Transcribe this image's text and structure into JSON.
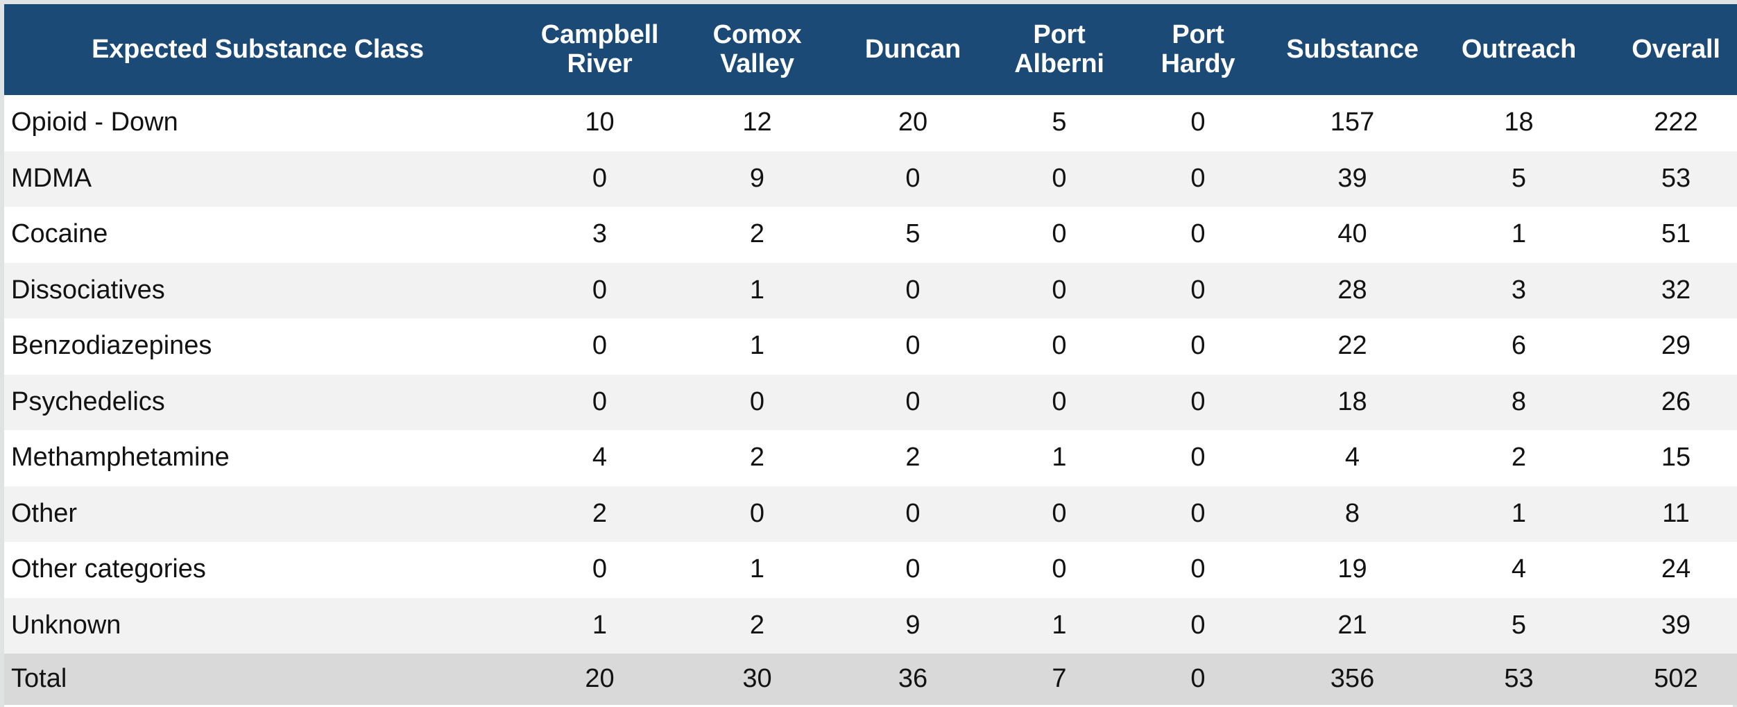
{
  "table": {
    "columns": [
      {
        "key": "class",
        "label": "Expected Substance Class",
        "align": "left"
      },
      {
        "key": "campbell_river",
        "label": "Campbell\nRiver",
        "align": "center"
      },
      {
        "key": "comox_valley",
        "label": "Comox\nValley",
        "align": "center"
      },
      {
        "key": "duncan",
        "label": "Duncan",
        "align": "center"
      },
      {
        "key": "port_alberni",
        "label": "Port\nAlberni",
        "align": "center"
      },
      {
        "key": "port_hardy",
        "label": "Port\nHardy",
        "align": "center"
      },
      {
        "key": "substance",
        "label": "Substance",
        "align": "center"
      },
      {
        "key": "outreach",
        "label": "Outreach",
        "align": "center"
      },
      {
        "key": "overall",
        "label": "Overall",
        "align": "center"
      }
    ],
    "rows": [
      {
        "class": "Opioid - Down",
        "campbell_river": "10",
        "comox_valley": "12",
        "duncan": "20",
        "port_alberni": "5",
        "port_hardy": "0",
        "substance": "157",
        "outreach": "18",
        "overall": "222"
      },
      {
        "class": "MDMA",
        "campbell_river": "0",
        "comox_valley": "9",
        "duncan": "0",
        "port_alberni": "0",
        "port_hardy": "0",
        "substance": "39",
        "outreach": "5",
        "overall": "53"
      },
      {
        "class": "Cocaine",
        "campbell_river": "3",
        "comox_valley": "2",
        "duncan": "5",
        "port_alberni": "0",
        "port_hardy": "0",
        "substance": "40",
        "outreach": "1",
        "overall": "51"
      },
      {
        "class": "Dissociatives",
        "campbell_river": "0",
        "comox_valley": "1",
        "duncan": "0",
        "port_alberni": "0",
        "port_hardy": "0",
        "substance": "28",
        "outreach": "3",
        "overall": "32"
      },
      {
        "class": "Benzodiazepines",
        "campbell_river": "0",
        "comox_valley": "1",
        "duncan": "0",
        "port_alberni": "0",
        "port_hardy": "0",
        "substance": "22",
        "outreach": "6",
        "overall": "29"
      },
      {
        "class": "Psychedelics",
        "campbell_river": "0",
        "comox_valley": "0",
        "duncan": "0",
        "port_alberni": "0",
        "port_hardy": "0",
        "substance": "18",
        "outreach": "8",
        "overall": "26"
      },
      {
        "class": "Methamphetamine",
        "campbell_river": "4",
        "comox_valley": "2",
        "duncan": "2",
        "port_alberni": "1",
        "port_hardy": "0",
        "substance": "4",
        "outreach": "2",
        "overall": "15"
      },
      {
        "class": "Other",
        "campbell_river": "2",
        "comox_valley": "0",
        "duncan": "0",
        "port_alberni": "0",
        "port_hardy": "0",
        "substance": "8",
        "outreach": "1",
        "overall": "11"
      },
      {
        "class": "Other categories",
        "campbell_river": "0",
        "comox_valley": "1",
        "duncan": "0",
        "port_alberni": "0",
        "port_hardy": "0",
        "substance": "19",
        "outreach": "4",
        "overall": "24"
      },
      {
        "class": "Unknown",
        "campbell_river": "1",
        "comox_valley": "2",
        "duncan": "9",
        "port_alberni": "1",
        "port_hardy": "0",
        "substance": "21",
        "outreach": "5",
        "overall": "39"
      }
    ],
    "total_row": {
      "class": "Total",
      "campbell_river": "20",
      "comox_valley": "30",
      "duncan": "36",
      "port_alberni": "7",
      "port_hardy": "0",
      "substance": "356",
      "outreach": "53",
      "overall": "502"
    }
  },
  "colors": {
    "header_background": "#1c4a77",
    "header_text": "#ffffff",
    "row_background": "#ffffff",
    "row_alt_background": "#f2f2f2",
    "total_background": "#d9d9d9",
    "body_text": "#121212",
    "outer_border": "#dfe3e3"
  }
}
